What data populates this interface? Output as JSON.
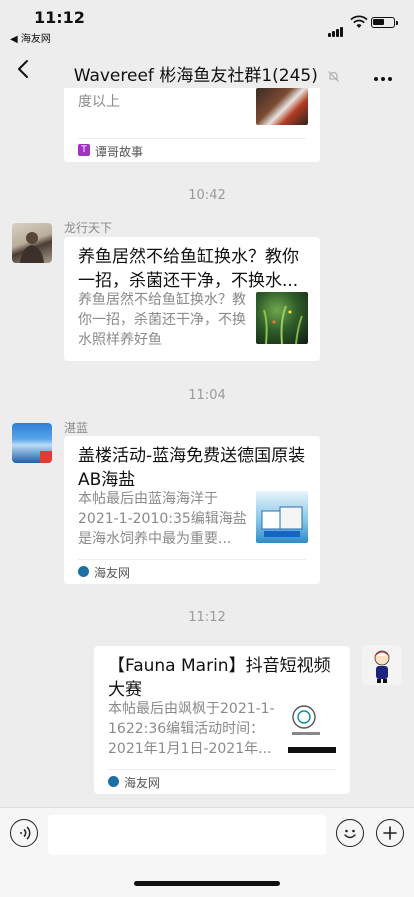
{
  "status_bar": {
    "time": "11:12",
    "back_app": "◀ 海友网"
  },
  "nav": {
    "title": "Wavereef 彬海鱼友社群1(245)"
  },
  "messages": [
    {
      "type": "partial-card",
      "desc": "度以上",
      "source": "谭哥故事",
      "source_color": "#a231c8"
    },
    {
      "type": "timestamp",
      "text": "10:42"
    },
    {
      "type": "card",
      "sender": "龙行天下",
      "title": "养鱼居然不给鱼缸换水？教你一招，杀菌还干净，不换水...",
      "desc": "养鱼居然不给鱼缸换水？教你一招，杀菌还干净，不换水照样养好鱼"
    },
    {
      "type": "timestamp",
      "text": "11:04"
    },
    {
      "type": "card",
      "sender": "湛蓝",
      "title": "盖楼活动-蓝海免费送德国原装AB海盐",
      "desc": "本帖最后由蓝海海洋于2021-1-2010:35编辑海盐是海水饲养中最为重要...",
      "source": "海友网"
    },
    {
      "type": "timestamp",
      "text": "11:12"
    },
    {
      "type": "card-self",
      "title": "【Fauna Marin】抖音短视频大赛",
      "desc": "本帖最后由飒枫于2021-1-1622:36编辑活动时间：2021年1月1日-2021年...",
      "source": "海友网"
    }
  ],
  "colors": {
    "background": "#ededed",
    "card": "#ffffff",
    "muted_text": "#8a8a8a"
  },
  "icons": {
    "back": "chevron-left-icon",
    "more": "more-dots-icon",
    "mute": "mute-bell-icon",
    "voice": "voice-icon",
    "emoji": "emoji-icon",
    "plus": "plus-icon"
  }
}
